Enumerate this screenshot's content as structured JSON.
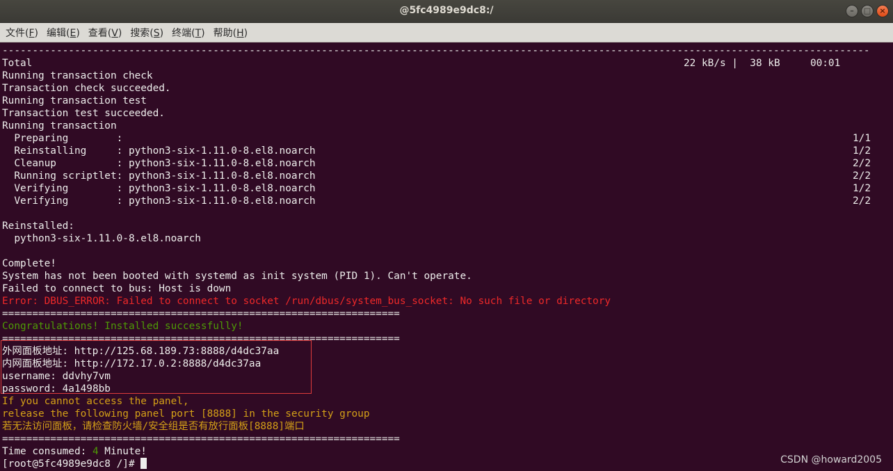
{
  "window": {
    "title": "@5fc4989e9dc8:/",
    "minimize_label": "–",
    "maximize_label": "□",
    "close_label": "×"
  },
  "menu": [
    {
      "label": "文件(",
      "key": "F",
      "end": ")"
    },
    {
      "label": "编辑(",
      "key": "E",
      "end": ")"
    },
    {
      "label": "查看(",
      "key": "V",
      "end": ")"
    },
    {
      "label": "搜索(",
      "key": "S",
      "end": ")"
    },
    {
      "label": "终端(",
      "key": "T",
      "end": ")"
    },
    {
      "label": "帮助(",
      "key": "H",
      "end": ")"
    }
  ],
  "terminal": {
    "separator_top": "------------------------------------------------------------------------------------------------------------------------------------------------",
    "total_label": "Total",
    "total_stats": "22 kB/s |  38 kB     00:01",
    "l_check": "Running transaction check",
    "l_check_ok": "Transaction check succeeded.",
    "l_test": "Running transaction test",
    "l_test_ok": "Transaction test succeeded.",
    "l_running": "Running transaction",
    "steps": [
      {
        "text": "  Preparing        :",
        "count": "1/1"
      },
      {
        "text": "  Reinstalling     : python3-six-1.11.0-8.el8.noarch",
        "count": "1/2"
      },
      {
        "text": "  Cleanup          : python3-six-1.11.0-8.el8.noarch",
        "count": "2/2"
      },
      {
        "text": "  Running scriptlet: python3-six-1.11.0-8.el8.noarch",
        "count": "2/2"
      },
      {
        "text": "  Verifying        : python3-six-1.11.0-8.el8.noarch",
        "count": "1/2"
      },
      {
        "text": "  Verifying        : python3-six-1.11.0-8.el8.noarch",
        "count": "2/2"
      }
    ],
    "reinstalled_label": "Reinstalled:",
    "reinstalled_pkg": "  python3-six-1.11.0-8.el8.noarch",
    "complete": "Complete!",
    "systemd_msg": "System has not been booted with systemd as init system (PID 1). Can't operate.",
    "bus_msg": "Failed to connect to bus: Host is down",
    "dbus_error": "Error: DBUS_ERROR: Failed to connect to socket /run/dbus/system_bus_socket: No such file or directory",
    "separator_eq": "==================================================================",
    "congrats": "Congratulations! Installed successfully!",
    "outer_url": "外网面板地址: http://125.68.189.73:8888/d4dc37aa",
    "inner_url": "内网面板地址: http://172.17.0.2:8888/d4dc37aa",
    "username": "username: ddvhy7vm",
    "password": "password: 4a1498bb",
    "notice1": "If you cannot access the panel,",
    "notice2": "release the following panel port [8888] in the security group",
    "notice3": "若无法访问面板，请检查防火墙/安全组是否有放行面板[8888]端口",
    "time_prefix": "Time consumed: ",
    "time_value": "4",
    "time_suffix": " Minute!",
    "prompt": "[root@5fc4989e9dc8 /]# "
  },
  "watermark": "CSDN @howard2005"
}
